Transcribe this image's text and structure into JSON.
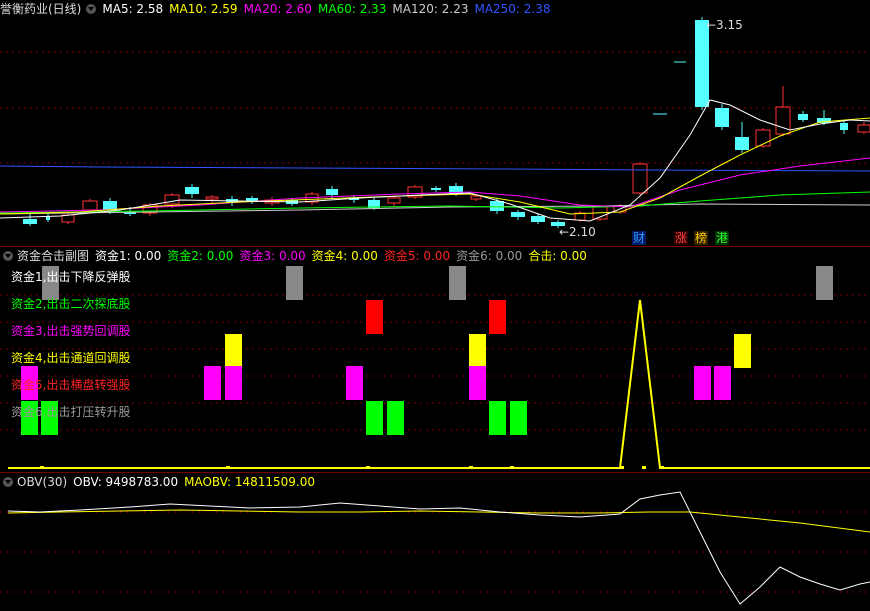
{
  "main": {
    "stock_title": "誉衡药业(日线)",
    "ma": [
      {
        "label": "MA5: 2.58",
        "color": "#ffffff"
      },
      {
        "label": "MA10: 2.59",
        "color": "#ffff00"
      },
      {
        "label": "MA20: 2.60",
        "color": "#ff00ff"
      },
      {
        "label": "MA60: 2.33",
        "color": "#00ff00"
      },
      {
        "label": "MA120: 2.23",
        "color": "#cccccc"
      },
      {
        "label": "MA250: 2.38",
        "color": "#3355ff"
      }
    ],
    "high_label": "←3.15",
    "low_label": "←2.10",
    "badges": [
      {
        "label": "财",
        "color": "#3399ff",
        "bg": "#001a66"
      },
      {
        "label": "涨",
        "color": "#ff4444",
        "bg": "#330000"
      },
      {
        "label": "榜",
        "color": "#ffcc00",
        "bg": "#332200"
      },
      {
        "label": "港",
        "color": "#33ff33",
        "bg": "#003300"
      }
    ]
  },
  "sub": {
    "title": "资金合击副图",
    "values": [
      {
        "label": "资金1: 0.00",
        "color": "#ffffff"
      },
      {
        "label": "资金2: 0.00",
        "color": "#00ff00"
      },
      {
        "label": "资金3: 0.00",
        "color": "#ff00ff"
      },
      {
        "label": "资金4: 0.00",
        "color": "#ffff00"
      },
      {
        "label": "资金5: 0.00",
        "color": "#ff2222"
      },
      {
        "label": "资金6: 0.00",
        "color": "#999999"
      },
      {
        "label": "合击: 0.00",
        "color": "#ffff00"
      }
    ],
    "signals": [
      {
        "label": "资金1,出击下降反弹股",
        "color": "#ffffff"
      },
      {
        "label": "资金2,出击二次探底股",
        "color": "#00ff00"
      },
      {
        "label": "资金3,出击强势回调股",
        "color": "#ff00ff"
      },
      {
        "label": "资金4,出击通道回调股",
        "color": "#ffff00"
      },
      {
        "label": "资金5,出击横盘转强股",
        "color": "#ff2222"
      },
      {
        "label": "资金6,出击打压转升股",
        "color": "#999999"
      }
    ]
  },
  "obv": {
    "title": "OBV(30)",
    "obv_label": "OBV: 9498783.00",
    "maobv_label": "MAOBV: 14811509.00"
  },
  "colors": {
    "up": "#ff3232",
    "down": "#54ffff",
    "grid": "#7a0000"
  }
}
